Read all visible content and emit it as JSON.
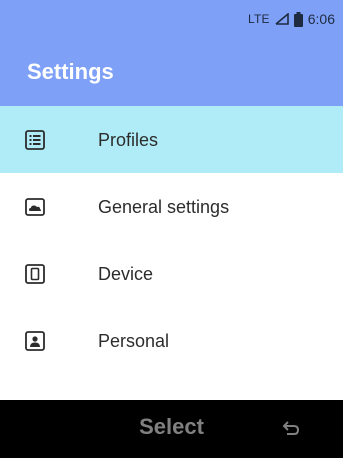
{
  "status_bar": {
    "network": "LTE",
    "signal_icon": "signal-icon",
    "battery_icon": "battery-icon",
    "time": "6:06"
  },
  "header": {
    "title": "Settings"
  },
  "menu": {
    "items": [
      {
        "label": "Profiles",
        "icon": "list-icon",
        "selected": true
      },
      {
        "label": "General settings",
        "icon": "cloud-icon",
        "selected": false
      },
      {
        "label": "Device",
        "icon": "device-icon",
        "selected": false
      },
      {
        "label": "Personal",
        "icon": "person-icon",
        "selected": false
      }
    ]
  },
  "softkeys": {
    "center_label": "Select",
    "right_icon": "back-icon"
  },
  "colors": {
    "header_bg": "#7ea0f7",
    "selected_row_bg": "#b0ecf7",
    "softkey_bar_bg": "#000000",
    "softkey_text": "#808080"
  }
}
